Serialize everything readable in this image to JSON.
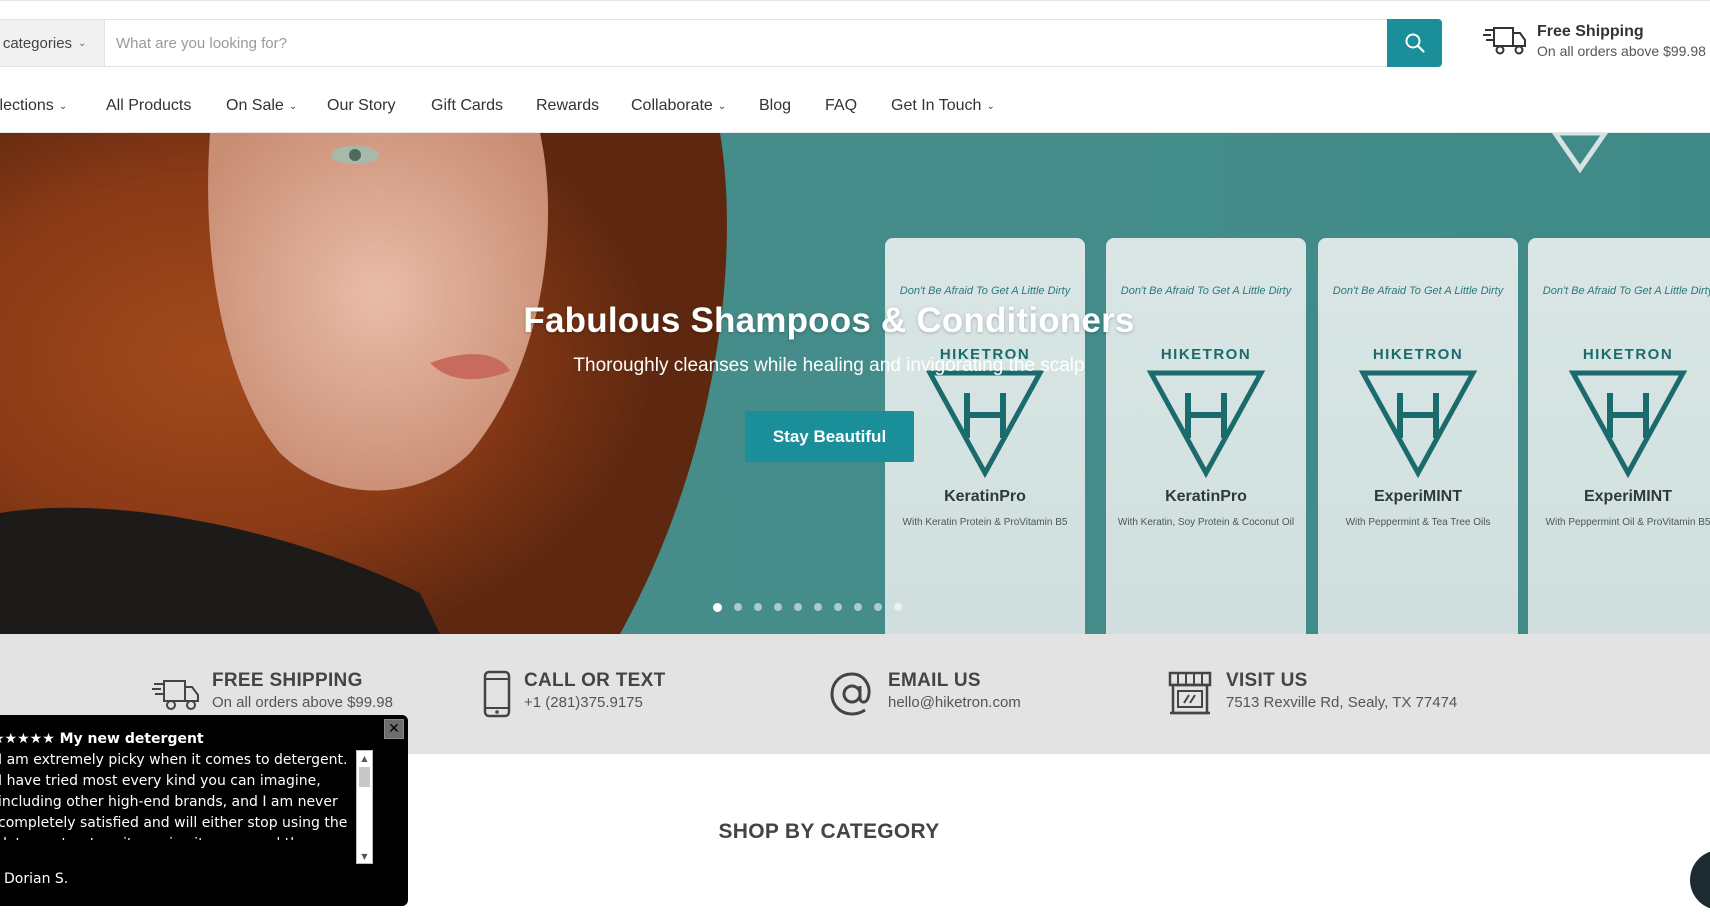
{
  "header": {
    "category_select": "ll categories",
    "search_placeholder": "What are you looking for?",
    "shipping_title": "Free Shipping",
    "shipping_sub": "On all orders above $99.98"
  },
  "nav": {
    "items": [
      {
        "label": "llections",
        "has_dropdown": true
      },
      {
        "label": "All Products",
        "has_dropdown": false
      },
      {
        "label": "On Sale",
        "has_dropdown": true
      },
      {
        "label": "Our Story",
        "has_dropdown": false
      },
      {
        "label": "Gift Cards",
        "has_dropdown": false
      },
      {
        "label": "Rewards",
        "has_dropdown": false
      },
      {
        "label": "Collaborate",
        "has_dropdown": true
      },
      {
        "label": "Blog",
        "has_dropdown": false
      },
      {
        "label": "FAQ",
        "has_dropdown": false
      },
      {
        "label": "Get In Touch",
        "has_dropdown": true
      }
    ]
  },
  "hero": {
    "title": "Fabulous Shampoos & Conditioners",
    "subtitle": "Thoroughly cleanses while healing and invigorating the scalp",
    "button": "Stay Beautiful",
    "slide_count": 10,
    "active_slide": 1,
    "products": [
      {
        "brand": "HIKETRON",
        "name": "KeratinPro",
        "slogan": "Don't Be Afraid To Get A Little Dirty",
        "with": "With Keratin Protein & ProVitamin B5"
      },
      {
        "brand": "HIKETRON",
        "name": "KeratinPro",
        "slogan": "Don't Be Afraid To Get A Little Dirty",
        "with": "With Keratin, Soy Protein & Coconut Oil"
      },
      {
        "brand": "HIKETRON",
        "name": "ExperiMINT",
        "slogan": "Don't Be Afraid To Get A Little Dirty",
        "with": "With Peppermint & Tea Tree Oils"
      },
      {
        "brand": "HIKETRON",
        "name": "ExperiMINT",
        "slogan": "Don't Be Afraid To Get A Little Dirty",
        "with": "With Peppermint Oil & ProVitamin B5"
      }
    ]
  },
  "info_bar": {
    "items": [
      {
        "icon": "truck-icon",
        "title": "FREE SHIPPING",
        "sub": "On all orders above $99.98"
      },
      {
        "icon": "phone-icon",
        "title": "CALL OR TEXT",
        "sub": "+1 (281)375.9175"
      },
      {
        "icon": "at-sign-icon",
        "title": "EMAIL US",
        "sub": "hello@hiketron.com"
      },
      {
        "icon": "storefront-icon",
        "title": "VISIT US",
        "sub": "7513 Rexville Rd, Sealy, TX 77474"
      }
    ]
  },
  "shop": {
    "title": "SHOP BY CATEGORY"
  },
  "review_popup": {
    "title": "★★★★★ My new detergent",
    "body": "I am extremely picky when it comes to detergent. I have tried most every kind you can imagine, including other high-end brands, and I am never completely satisfied and will either stop using the detergent, return it, or give it away, and then my",
    "author": "Dorian S.",
    "close": "✕"
  },
  "colors": {
    "accent": "#1a8f99",
    "hero_bg": "#3f8d8a",
    "info_bg": "#e3e3e3"
  }
}
